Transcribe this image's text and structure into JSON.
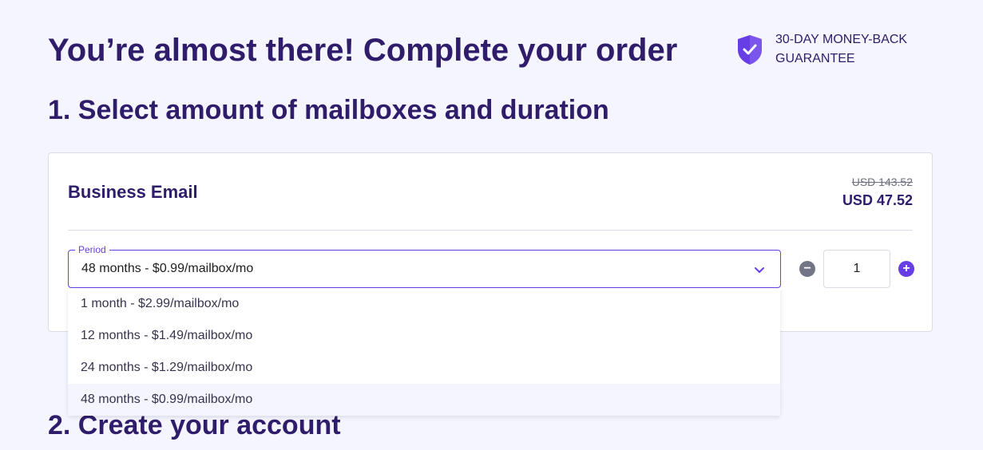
{
  "page_title": "You’re almost there! Complete your order",
  "guarantee": {
    "line1": "30-DAY MONEY-BACK",
    "line2": "GUARANTEE",
    "icon": "shield-check-icon"
  },
  "sections": {
    "step1_title": "1. Select amount of mailboxes and duration",
    "step2_title": "2. Create your account"
  },
  "product": {
    "name": "Business Email",
    "price_old": "USD 143.52",
    "price_new": "USD 47.52"
  },
  "period_select": {
    "legend": "Period",
    "selected": "48 months - $0.99/mailbox/mo",
    "options": [
      "1 month - $2.99/mailbox/mo",
      "12 months - $1.49/mailbox/mo",
      "24 months - $1.29/mailbox/mo",
      "48 months - $0.99/mailbox/mo"
    ]
  },
  "quantity": {
    "value": "1",
    "minus": "−",
    "plus": "+"
  },
  "colors": {
    "primary": "#673de6",
    "heading": "#2f1c6a",
    "background": "#f4f5ff"
  }
}
